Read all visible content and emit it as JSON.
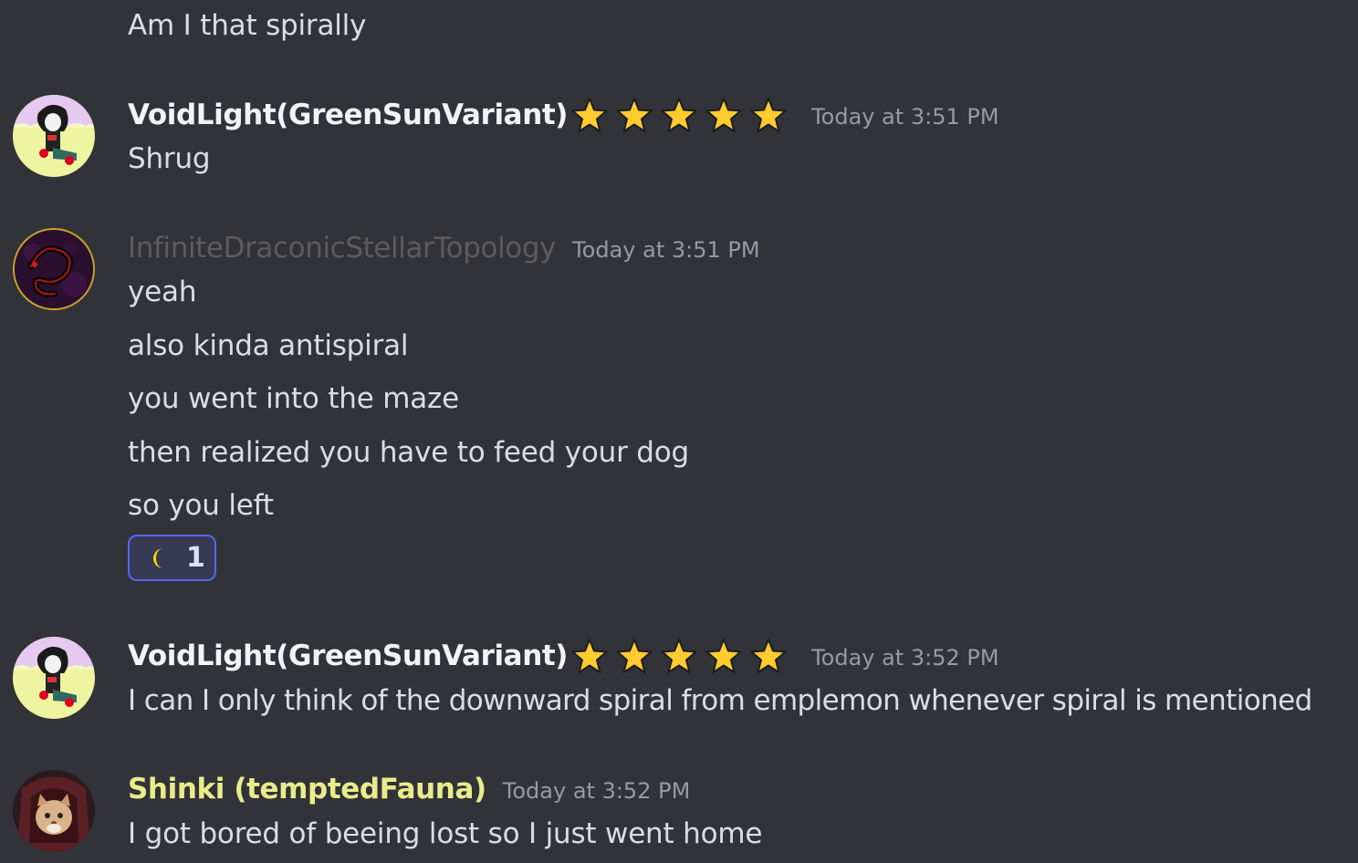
{
  "colors": {
    "background": "#313338",
    "message_text": "#dbdee1",
    "timestamp": "#949ba4",
    "voidlight_name": "#f2f3f5",
    "infinite_name": "#5f5b5a",
    "shinki_name": "#e9ec8a",
    "star": "#ffcb2f",
    "reaction_border": "#5865f2",
    "reaction_bg": "#373a54"
  },
  "messages": [
    {
      "continuation_lines": [
        "Am I that spirally"
      ]
    },
    {
      "author": "VoidLight(GreenSunVariant)",
      "badges": [
        "star-icon",
        "star-icon",
        "star-icon",
        "star-icon",
        "star-icon"
      ],
      "timestamp": "Today at 3:51 PM",
      "lines": [
        "Shrug"
      ]
    },
    {
      "author": "InfiniteDraconicStellarTopology",
      "timestamp": "Today at 3:51 PM",
      "lines": [
        "yeah",
        "also kinda antispiral",
        "you went into the maze",
        "then realized you have to feed your dog",
        "so you left"
      ],
      "reaction": {
        "emoji": "crescent-moon-icon",
        "count": "1"
      }
    },
    {
      "author": "VoidLight(GreenSunVariant)",
      "badges": [
        "star-icon",
        "star-icon",
        "star-icon",
        "star-icon",
        "star-icon"
      ],
      "timestamp": "Today at 3:52 PM",
      "lines": [
        "I can I only think of the downward spiral from emplemon whenever spiral is mentioned"
      ]
    },
    {
      "author": "Shinki (temptedFauna)",
      "timestamp": "Today at 3:52 PM",
      "lines": [
        "I got bored of beeing lost so I just went home"
      ]
    }
  ]
}
